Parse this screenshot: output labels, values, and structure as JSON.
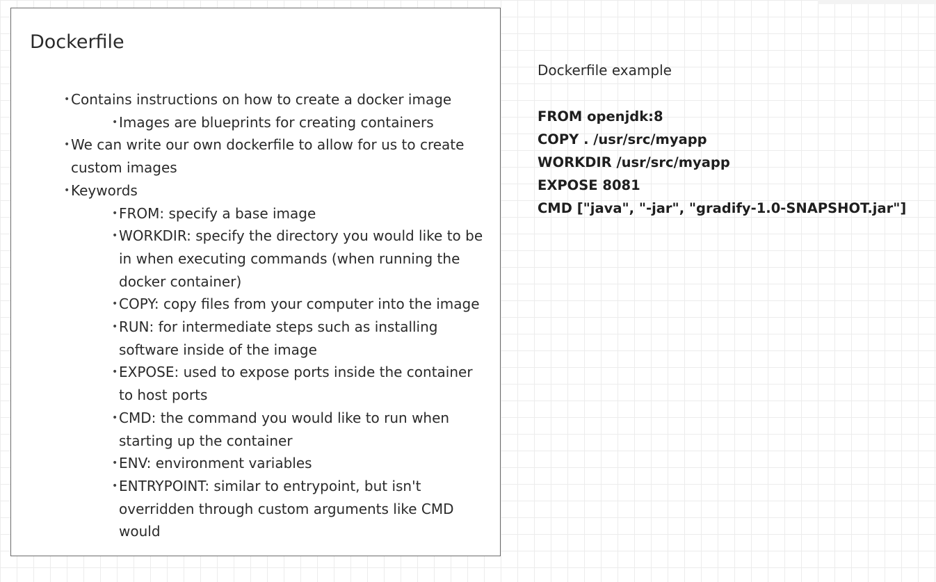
{
  "frame": {
    "title": "Dockerfile",
    "bullets": [
      {
        "level": 1,
        "text": "Contains instructions on how to create a docker image"
      },
      {
        "level": 2,
        "text": "Images are blueprints for creating containers"
      },
      {
        "level": 1,
        "text": "We can write our own dockerfile to allow for us to create custom images"
      },
      {
        "level": 1,
        "text": "Keywords"
      },
      {
        "level": 2,
        "text": "FROM: specify a base image"
      },
      {
        "level": 2,
        "text": "WORKDIR: specify the directory you would like to be in when executing commands (when running the docker container)"
      },
      {
        "level": 2,
        "text": "COPY: copy files from your computer into the image"
      },
      {
        "level": 2,
        "text": "RUN: for intermediate steps such as installing software inside of the image"
      },
      {
        "level": 2,
        "text": "EXPOSE: used to expose ports inside the container to host ports"
      },
      {
        "level": 2,
        "text": "CMD: the command you would like to run when starting up the container"
      },
      {
        "level": 2,
        "text": "ENV: environment variables"
      },
      {
        "level": 2,
        "text": "ENTRYPOINT: similar to entrypoint, but isn't overridden through custom arguments like CMD would"
      }
    ]
  },
  "example": {
    "caption": "Dockerfile example",
    "lines": [
      "FROM openjdk:8",
      "COPY . /usr/src/myapp",
      "WORKDIR /usr/src/myapp",
      "EXPOSE 8081",
      "CMD [\"java\", \"-jar\", \"gradify-1.0-SNAPSHOT.jar\"]"
    ]
  },
  "colors": {
    "background": "#ffffff",
    "grid": "#ececec",
    "frame_border": "#6b6b6b",
    "text": "#2a2a2a"
  }
}
